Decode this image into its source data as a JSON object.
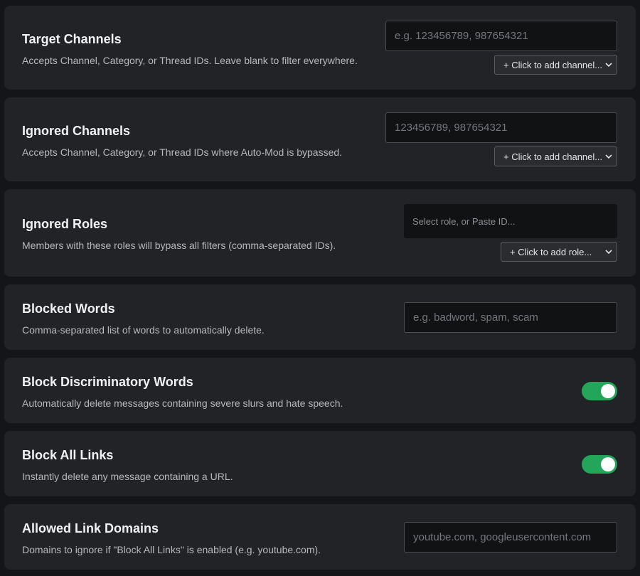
{
  "settings": {
    "target_channels": {
      "title": "Target Channels",
      "description": "Accepts Channel, Category, or Thread IDs. Leave blank to filter everywhere.",
      "input_placeholder": "e.g. 123456789, 987654321",
      "select_label": "+ Click to add channel..."
    },
    "ignored_channels": {
      "title": "Ignored Channels",
      "description": "Accepts Channel, Category, or Thread IDs where Auto-Mod is bypassed.",
      "input_placeholder": "123456789, 987654321",
      "select_label": "+ Click to add channel..."
    },
    "ignored_roles": {
      "title": "Ignored Roles",
      "description": "Members with these roles will bypass all filters (comma-separated IDs).",
      "input_placeholder": "Select role, or Paste ID...",
      "select_label": "+ Click to add role..."
    },
    "blocked_words": {
      "title": "Blocked Words",
      "description": "Comma-separated list of words to automatically delete.",
      "input_placeholder": "e.g. badword, spam, scam"
    },
    "block_discriminatory": {
      "title": "Block Discriminatory Words",
      "description": "Automatically delete messages containing severe slurs and hate speech.",
      "enabled": true
    },
    "block_all_links": {
      "title": "Block All Links",
      "description": "Instantly delete any message containing a URL.",
      "enabled": true
    },
    "allowed_domains": {
      "title": "Allowed Link Domains",
      "description": "Domains to ignore if \"Block All Links\" is enabled (e.g. youtube.com).",
      "input_placeholder": "youtube.com, googleusercontent.com"
    }
  },
  "colors": {
    "page_bg": "#141518",
    "card_bg": "#222327",
    "toggle_on": "#23a55a",
    "input_bg": "#111214"
  },
  "icons": {
    "select_arrow": "chevron-down-icon"
  }
}
